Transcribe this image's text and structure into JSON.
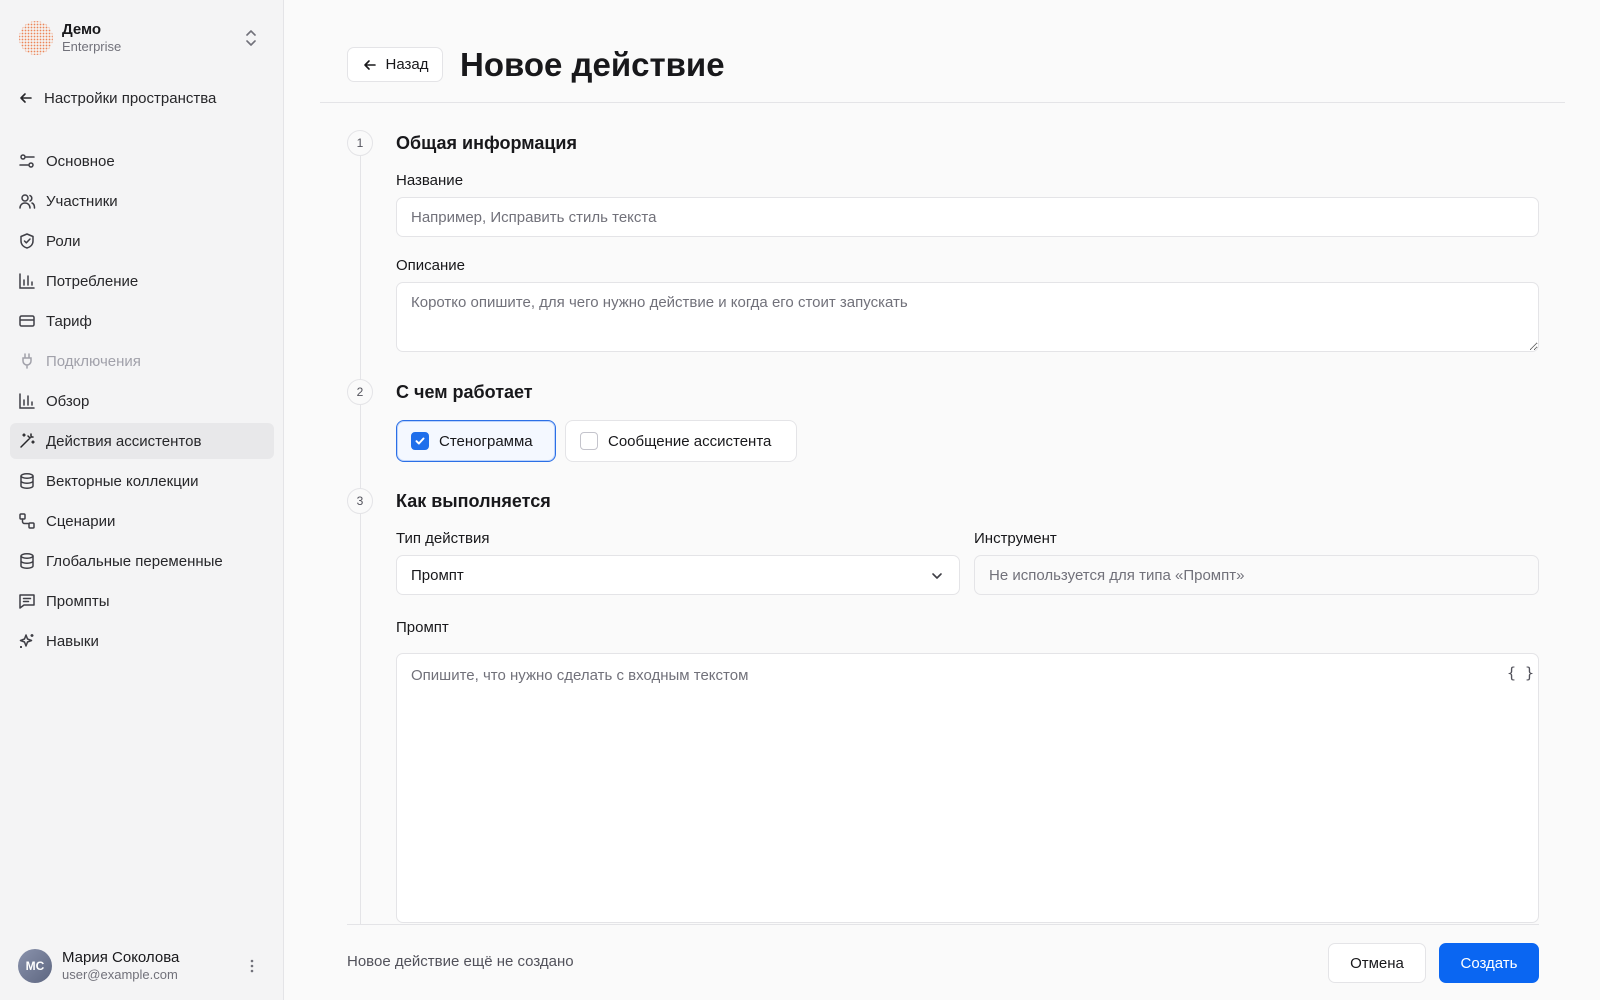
{
  "workspace": {
    "name": "Демо",
    "plan": "Enterprise"
  },
  "sidebar": {
    "back_label": "Настройки пространства",
    "items": [
      {
        "label": "Основное",
        "icon": "sliders-icon",
        "active": false,
        "disabled": false
      },
      {
        "label": "Участники",
        "icon": "users-icon",
        "active": false,
        "disabled": false
      },
      {
        "label": "Роли",
        "icon": "shield-icon",
        "active": false,
        "disabled": false
      },
      {
        "label": "Потребление",
        "icon": "bar-chart-icon",
        "active": false,
        "disabled": false
      },
      {
        "label": "Тариф",
        "icon": "credit-card-icon",
        "active": false,
        "disabled": false
      },
      {
        "label": "Подключения",
        "icon": "plug-icon",
        "active": false,
        "disabled": true
      },
      {
        "label": "Обзор",
        "icon": "bar-chart-icon",
        "active": false,
        "disabled": false
      },
      {
        "label": "Действия ассистентов",
        "icon": "magic-wand-icon",
        "active": true,
        "disabled": false
      },
      {
        "label": "Векторные коллекции",
        "icon": "database-icon",
        "active": false,
        "disabled": false
      },
      {
        "label": "Сценарии",
        "icon": "workflow-icon",
        "active": false,
        "disabled": false
      },
      {
        "label": "Глобальные переменные",
        "icon": "database-icon",
        "active": false,
        "disabled": false
      },
      {
        "label": "Промпты",
        "icon": "message-square-icon",
        "active": false,
        "disabled": false
      },
      {
        "label": "Навыки",
        "icon": "sparkles-icon",
        "active": false,
        "disabled": false
      }
    ]
  },
  "user": {
    "initials": "МС",
    "name": "Мария Соколова",
    "email": "user@example.com"
  },
  "header": {
    "back_label": "Назад",
    "title": "Новое действие"
  },
  "sections": {
    "s1": {
      "number": "1",
      "title": "Общая информация"
    },
    "s2": {
      "number": "2",
      "title": "С чем работает"
    },
    "s3": {
      "number": "3",
      "title": "Как выполняется"
    }
  },
  "form": {
    "name_label": "Название",
    "name_value": "",
    "name_placeholder": "Например, Исправить стиль текста",
    "desc_label": "Описание",
    "desc_value": "",
    "desc_placeholder": "Коротко опишите, для чего нужно действие и когда его стоит запускать",
    "sources": [
      {
        "label": "Стенограмма",
        "checked": true
      },
      {
        "label": "Сообщение ассистента",
        "checked": false
      }
    ],
    "type_label": "Тип действия",
    "type_value": "Промпт",
    "tool_label": "Инструмент",
    "tool_placeholder": "Не используется для типа «Промпт»",
    "prompt_label": "Промпт",
    "prompt_placeholder": "Опишите, что нужно сделать с входным текстом",
    "braces": "{ }"
  },
  "footer": {
    "status": "Новое действие ещё не создано",
    "cancel_label": "Отмена",
    "create_label": "Создать"
  },
  "colors": {
    "primary": "#0a66f2",
    "active_nav": "#e8e8ea",
    "border": "#e4e4e7"
  }
}
